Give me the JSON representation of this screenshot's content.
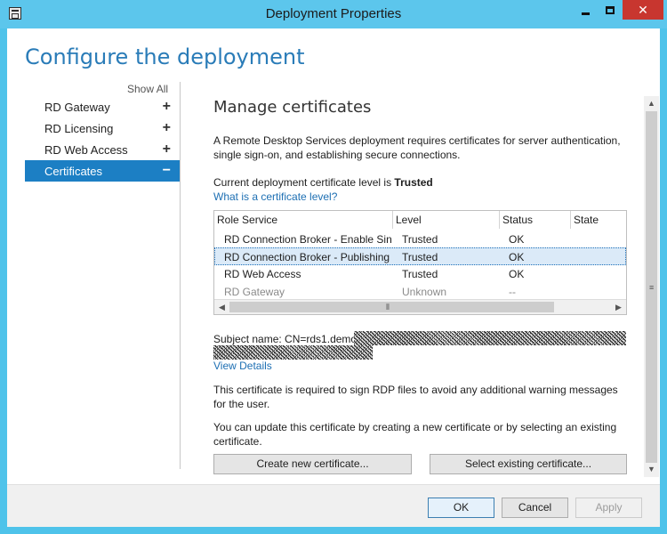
{
  "window": {
    "title": "Deployment Properties",
    "close_label": "✕"
  },
  "heading": "Configure the deployment",
  "nav": {
    "show_all": "Show All",
    "items": [
      {
        "label": "RD Gateway",
        "symbol": "+"
      },
      {
        "label": "RD Licensing",
        "symbol": "+"
      },
      {
        "label": "RD Web Access",
        "symbol": "+"
      },
      {
        "label": "Certificates",
        "symbol": "−"
      }
    ]
  },
  "main": {
    "section_title": "Manage certificates",
    "intro": "A Remote Desktop Services deployment requires certificates for server authentication, single sign-on, and establishing secure connections.",
    "level_prefix": "Current deployment certificate level is ",
    "level_value": "Trusted",
    "level_link": "What is a certificate level?",
    "table": {
      "columns": [
        "Role Service",
        "Level",
        "Status",
        "State"
      ],
      "rows": [
        {
          "role": "RD Connection Broker - Enable Sing",
          "level": "Trusted",
          "status": "OK",
          "state": ""
        },
        {
          "role": "RD Connection Broker - Publishing",
          "level": "Trusted",
          "status": "OK",
          "state": ""
        },
        {
          "role": "RD Web Access",
          "level": "Trusted",
          "status": "OK",
          "state": ""
        },
        {
          "role": "RD Gateway",
          "level": "Unknown",
          "status": "--",
          "state": ""
        }
      ],
      "selected_row": 2
    },
    "subject_prefix": "Subject name: CN=rds1.demo",
    "view_details": "View Details",
    "note1": "This certificate is required to sign RDP files to avoid any additional warning messages for the user.",
    "note2": "You can update this certificate by creating a new certificate or by selecting an existing certificate.",
    "create_button": "Create new certificate...",
    "select_button": "Select existing certificate..."
  },
  "footer": {
    "ok": "OK",
    "cancel": "Cancel",
    "apply": "Apply"
  },
  "colors": {
    "title_bar": "#5cc6ec",
    "heading": "#2a7cb8",
    "nav_selected": "#1c7fc4",
    "close_button": "#c8362f",
    "link": "#1d6fb3"
  }
}
